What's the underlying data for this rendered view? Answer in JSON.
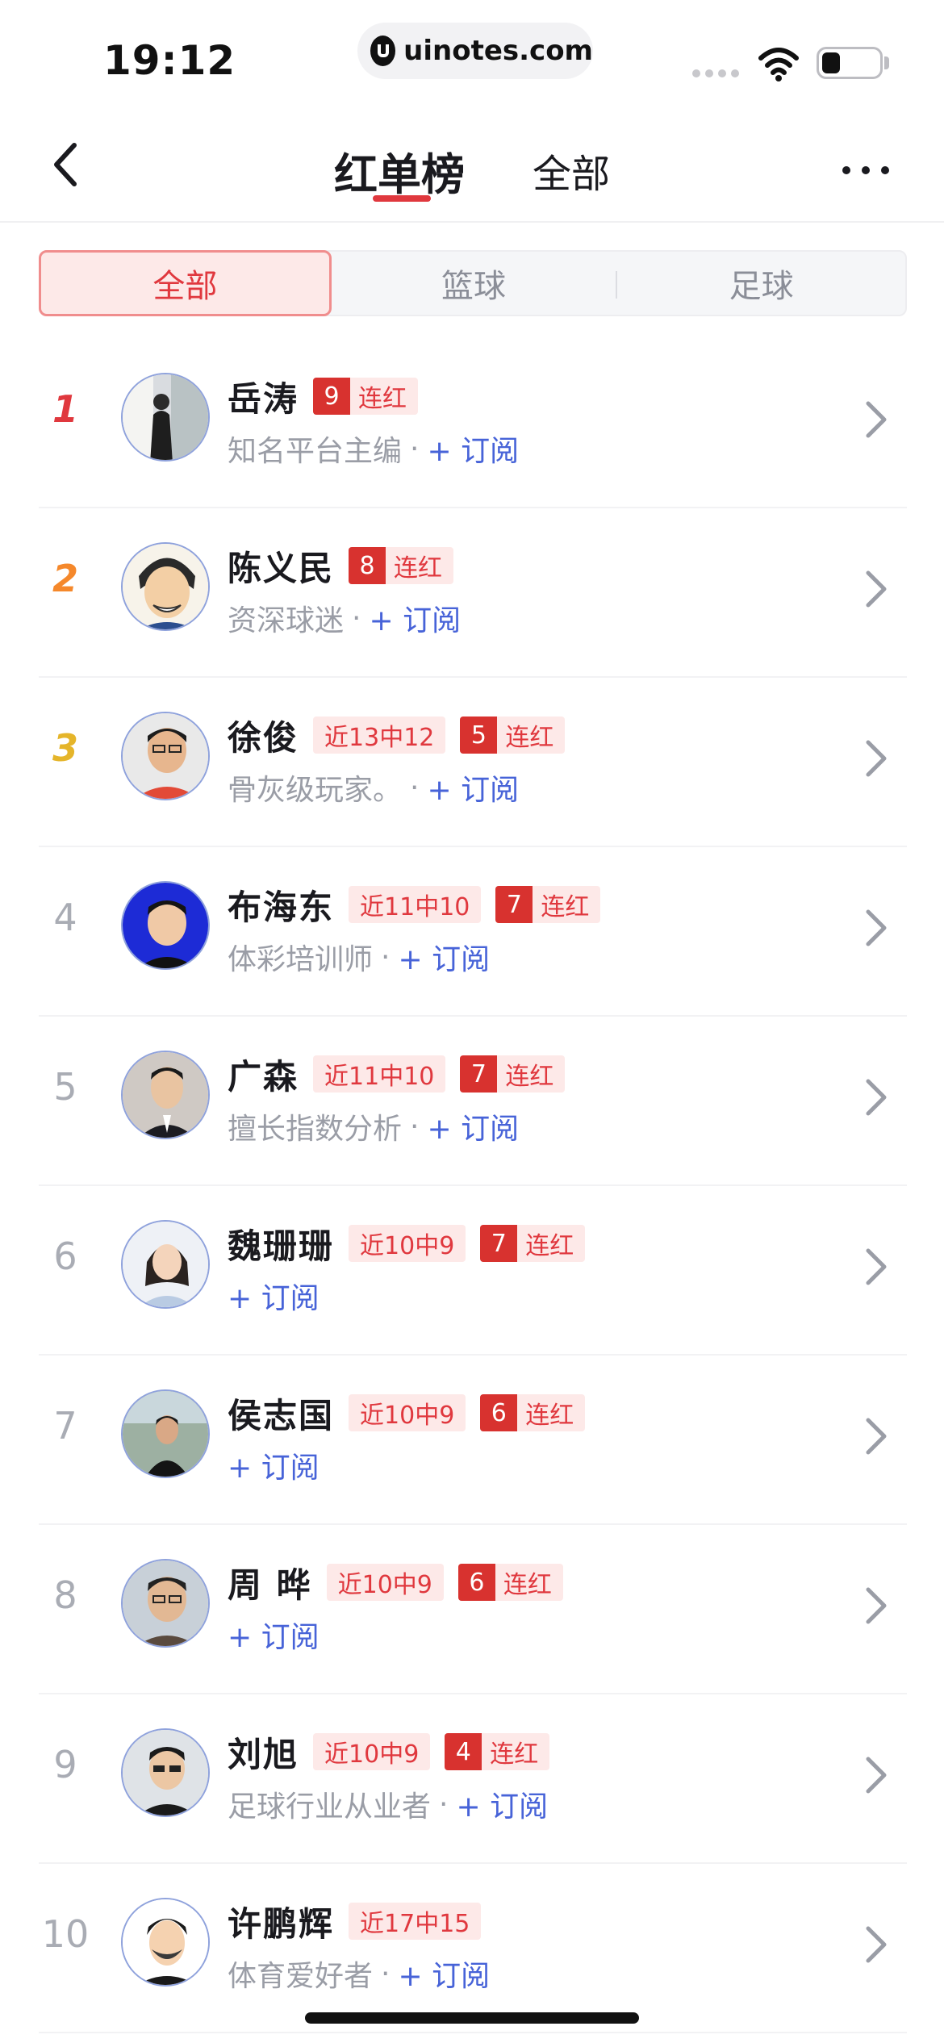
{
  "status_bar": {
    "time": "19:12",
    "url": "uinotes.com"
  },
  "nav": {
    "active_tab": "红单榜",
    "tab_all": "全部"
  },
  "segment": {
    "items": [
      "全部",
      "篮球",
      "足球"
    ],
    "active_index": 0
  },
  "accent_color": "#e0383e",
  "link_color": "#4763d8",
  "subscribe_label": "+ 订阅",
  "streak_label": "连红",
  "list": [
    {
      "rank": "1",
      "name": "岳涛",
      "record": "",
      "streak": "9",
      "desc": "知名平台主编"
    },
    {
      "rank": "2",
      "name": "陈义民",
      "record": "",
      "streak": "8",
      "desc": "资深球迷"
    },
    {
      "rank": "3",
      "name": "徐俊",
      "record": "近13中12",
      "streak": "5",
      "desc": "骨灰级玩家。"
    },
    {
      "rank": "4",
      "name": "布海东",
      "record": "近11中10",
      "streak": "7",
      "desc": "体彩培训师"
    },
    {
      "rank": "5",
      "name": "广森",
      "record": "近11中10",
      "streak": "7",
      "desc": "擅长指数分析"
    },
    {
      "rank": "6",
      "name": "魏珊珊",
      "record": "近10中9",
      "streak": "7",
      "desc": ""
    },
    {
      "rank": "7",
      "name": "侯志国",
      "record": "近10中9",
      "streak": "6",
      "desc": ""
    },
    {
      "rank": "8",
      "name": "周 晔",
      "record": "近10中9",
      "streak": "6",
      "desc": ""
    },
    {
      "rank": "9",
      "name": "刘旭",
      "record": "近10中9",
      "streak": "4",
      "desc": "足球行业从业者"
    },
    {
      "rank": "10",
      "name": "许鹏辉",
      "record": "近17中15",
      "streak": "",
      "desc": "体育爱好者"
    }
  ]
}
